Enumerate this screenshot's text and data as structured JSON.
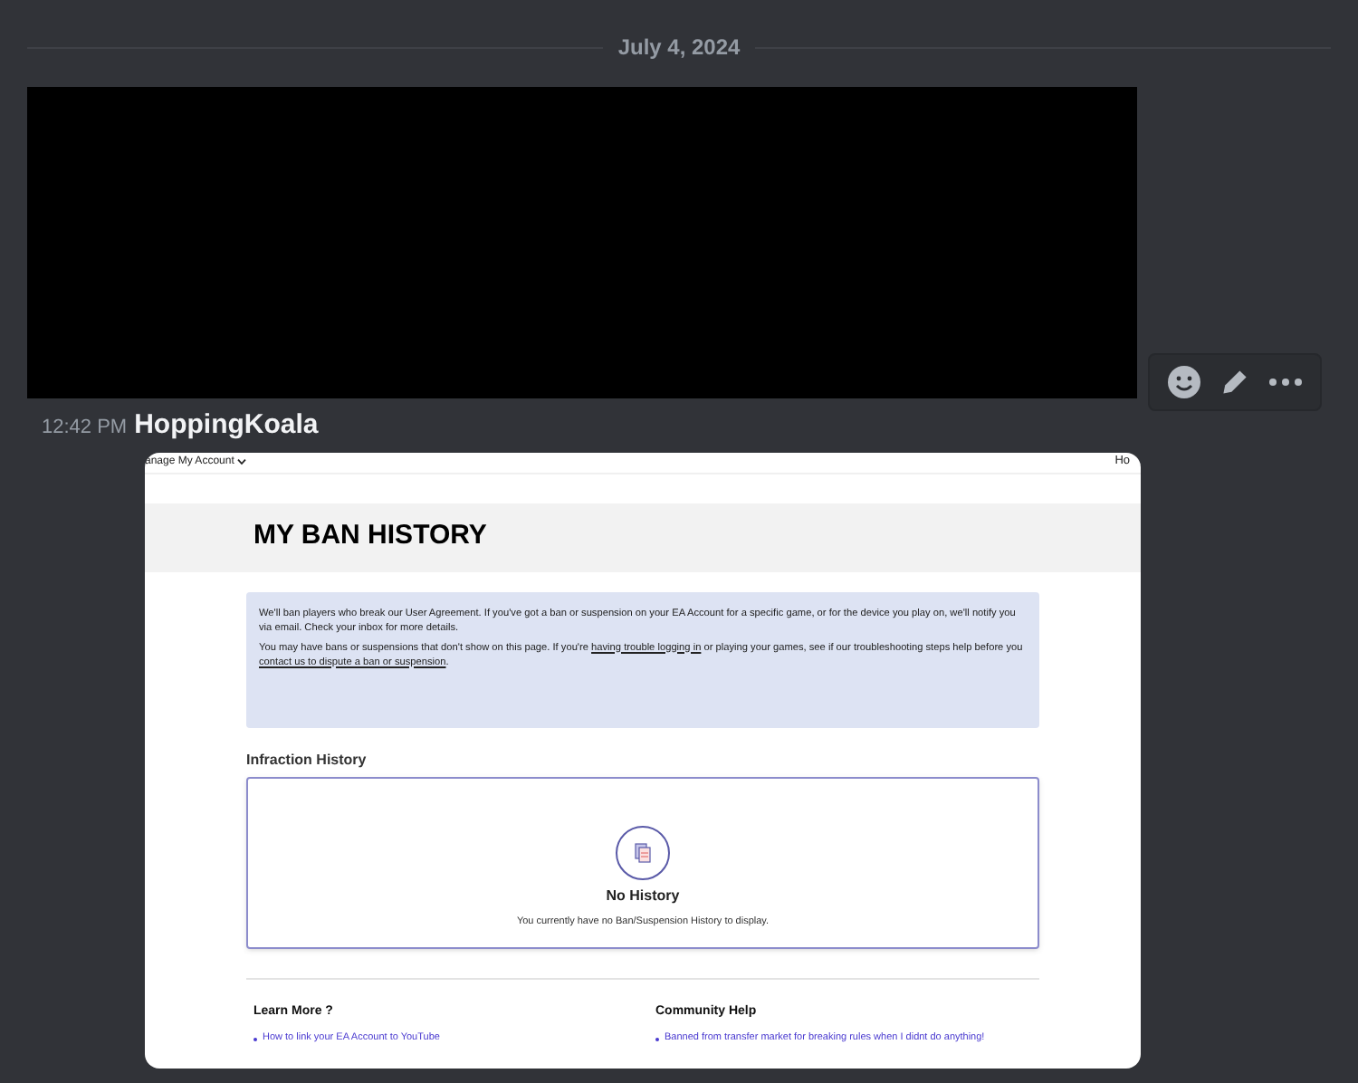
{
  "date_divider": "July 4, 2024",
  "message": {
    "time": "12:42 PM",
    "author": "HoppingKoala"
  },
  "embed": {
    "nav": {
      "left": "anage My Account",
      "right": "Ho"
    },
    "title": "MY BAN HISTORY",
    "info": [
      "We'll ban players who break our User Agreement. If you've got a ban or suspension on your EA Account for a specific game, or for the device you play on, we'll notify you via email. Check your inbox for more details.",
      "You may have bans or suspensions that don't show on this page. If you're **having trouble logging in** or playing your games, see if our troubleshooting steps help before you **contact us to dispute a ban or suspension**."
    ],
    "history_heading": "Infraction History",
    "empty_title": "No History",
    "empty_text": "You currently have no Ban/Suspension History to display.",
    "columns": [
      {
        "heading": "Learn More ?",
        "links": [
          "How to link your EA Account to YouTube"
        ]
      },
      {
        "heading": "Community Help",
        "links": [
          "Banned from transfer market for breaking rules when I didnt do anything!"
        ]
      }
    ]
  }
}
